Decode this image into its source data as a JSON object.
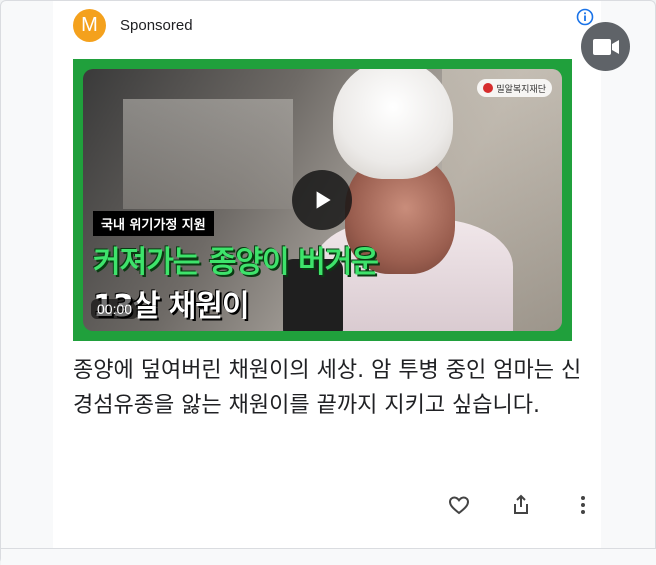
{
  "ad": {
    "avatar_letter": "M",
    "sponsored_label": "Sponsored",
    "info_icon": "info-icon",
    "video_icon": "video-camera-icon",
    "colors": {
      "avatar": "#f4a11d",
      "thumbnail_border": "#20a03c",
      "headline_green": "#3ee36b",
      "info_blue": "#1a73e8",
      "badge_gray": "#5f6368"
    }
  },
  "thumbnail": {
    "logo_text": "밀알복지재단",
    "caption_label": "국내 위기가정 지원",
    "headline_line1": "커져가는 종양이 버거운",
    "headline_line2": "13살 채원이",
    "duration": "00:00",
    "play_icon": "play-icon"
  },
  "description": "종양에 덮여버린 채원이의 세상. 암 투병 중인 엄마는 신경섬유종을 앓는 채원이를 끝까지 지키고 싶습니다.",
  "actions": {
    "like_icon": "heart-icon",
    "share_icon": "share-icon",
    "more_icon": "more-vert-icon"
  }
}
